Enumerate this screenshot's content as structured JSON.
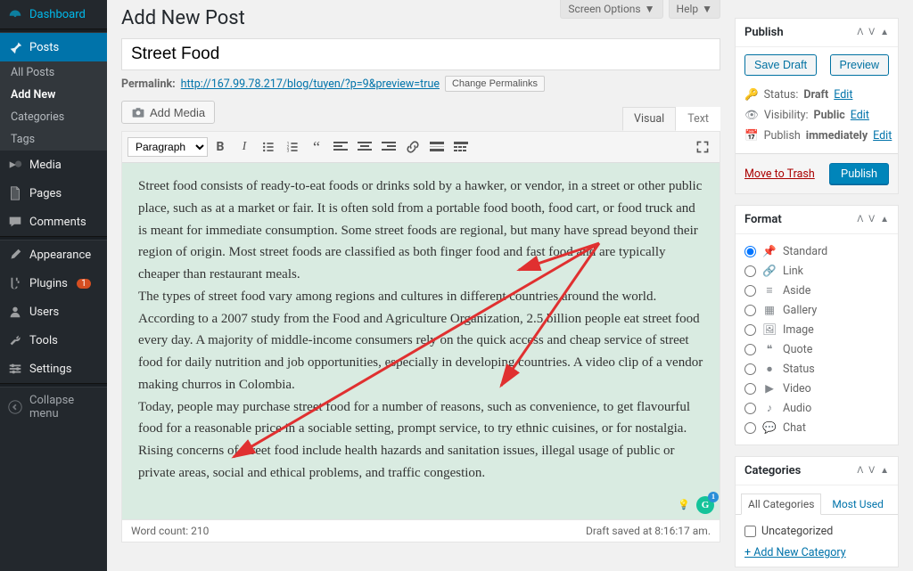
{
  "top_tabs": {
    "screen_options": "Screen Options",
    "help": "Help"
  },
  "sidebar": {
    "items": [
      {
        "icon": "gauge",
        "label": "Dashboard"
      },
      {
        "icon": "pin",
        "label": "Posts",
        "current": true
      },
      {
        "icon": "media",
        "label": "Media"
      },
      {
        "icon": "page",
        "label": "Pages"
      },
      {
        "icon": "comment",
        "label": "Comments"
      },
      {
        "icon": "appearance",
        "label": "Appearance"
      },
      {
        "icon": "plugin",
        "label": "Plugins",
        "badge": "1"
      },
      {
        "icon": "user",
        "label": "Users"
      },
      {
        "icon": "tool",
        "label": "Tools"
      },
      {
        "icon": "settings",
        "label": "Settings"
      },
      {
        "icon": "collapse",
        "label": "Collapse menu"
      }
    ],
    "posts_sub": [
      "All Posts",
      "Add New",
      "Categories",
      "Tags"
    ]
  },
  "page_title": "Add New Post",
  "post_title": "Street Food",
  "permalink_label": "Permalink:",
  "permalink_url": "http://167.99.78.217/blog/tuyen/?p=9&preview=true",
  "change_permalinks_btn": "Change Permalinks",
  "add_media_btn": "Add Media",
  "editor_tabs": {
    "visual": "Visual",
    "text": "Text"
  },
  "toolbar": {
    "format": "Paragraph"
  },
  "editor_body": "Street food consists of ready-to-eat foods or drinks sold by a hawker, or vendor, in a street or other public place, such as at a market or fair. It is often sold from a portable food booth, food cart, or food truck and is meant for immediate consumption. Some street foods are regional, but many have spread beyond their region of origin. Most street foods are classified as both finger food and fast food and are typically cheaper than restaurant meals.\nThe types of street food vary among regions and cultures in different countries around the world. According to a 2007 study from the Food and Agriculture Organization, 2.5 billion people eat street food every day. A majority of middle-income consumers rely on the quick access and cheap service of street food for daily nutrition and job opportunities, especially in developing countries. A video clip of a vendor making churros in Colombia.\nToday, people may purchase street food for a number of reasons, such as convenience, to get flavourful food for a reasonable price in a sociable setting, prompt service, to try ethnic cuisines, or for nostalgia.\nRising concerns of street food include health hazards and sanitation issues, illegal usage of public or private areas, social and ethical problems, and traffic congestion.",
  "word_count_label": "Word count: 210",
  "draft_saved": "Draft saved at 8:16:17 am.",
  "publish_box": {
    "title": "Publish",
    "save_draft": "Save Draft",
    "preview": "Preview",
    "status_label": "Status:",
    "status_value": "Draft",
    "edit": "Edit",
    "visibility_label": "Visibility:",
    "visibility_value": "Public",
    "publish_label": "Publish",
    "publish_value": "immediately",
    "trash": "Move to Trash",
    "publish_btn": "Publish"
  },
  "format_box": {
    "title": "Format",
    "options": [
      "Standard",
      "Link",
      "Aside",
      "Gallery",
      "Image",
      "Quote",
      "Status",
      "Video",
      "Audio",
      "Chat"
    ]
  },
  "categories_box": {
    "title": "Categories",
    "tabs": {
      "all": "All Categories",
      "used": "Most Used"
    },
    "items": [
      "Uncategorized"
    ],
    "add": "+ Add New Category"
  }
}
